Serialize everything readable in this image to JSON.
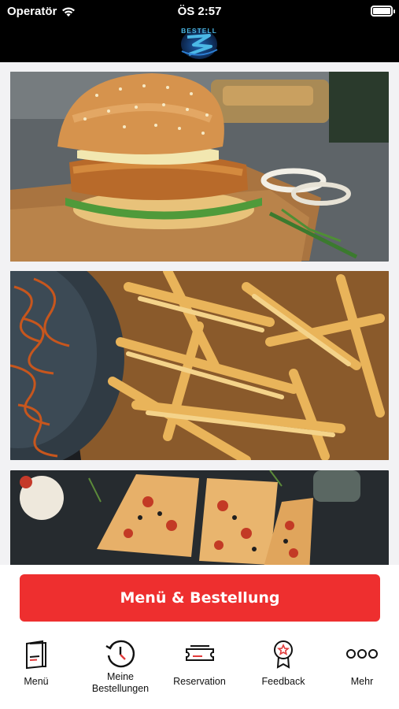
{
  "status_bar": {
    "carrier": "Operatör",
    "time": "ÖS 2:57",
    "wifi_icon": "wifi-icon",
    "battery_icon": "battery-icon"
  },
  "header": {
    "logo_text": "BESTELL",
    "logo_icon": "bestell-logo"
  },
  "cards": [
    {
      "icon": "burger-image"
    },
    {
      "icon": "fries-image"
    },
    {
      "icon": "pizza-image"
    }
  ],
  "cta": {
    "label": "Menü & Bestellung",
    "color": "#ee2f2f"
  },
  "tabbar": {
    "items": [
      {
        "label": "Menü",
        "icon": "menu-card-icon"
      },
      {
        "label": "Meine\nBestellungen",
        "icon": "history-clock-icon"
      },
      {
        "label": "Reservation",
        "icon": "ticket-icon"
      },
      {
        "label": "Feedback",
        "icon": "award-ribbon-icon"
      },
      {
        "label": "Mehr",
        "icon": "more-dots-icon"
      }
    ]
  }
}
